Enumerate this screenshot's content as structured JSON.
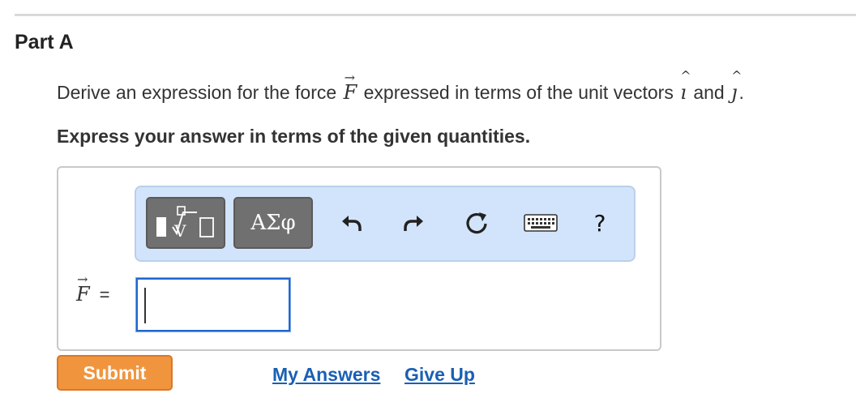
{
  "part": {
    "title": "Part A"
  },
  "question": {
    "prefix": "Derive an expression for the force",
    "force_symbol": "F",
    "middle": "expressed in terms of the unit vectors",
    "unit_i": "ı",
    "conjunction": "and",
    "unit_j": "ȷ",
    "suffix": "."
  },
  "instruction": "Express your answer in terms of the given quantities.",
  "toolbar": {
    "templates_icon": "math-templates-icon",
    "symbols_label": "ΑΣφ",
    "undo_icon": "undo-icon",
    "redo_icon": "redo-icon",
    "reset_icon": "reset-icon",
    "keyboard_icon": "keyboard-icon",
    "help_label": "?"
  },
  "answer": {
    "label_symbol": "F",
    "equals": "=",
    "value": ""
  },
  "actions": {
    "submit_label": "Submit",
    "my_answers_label": "My Answers",
    "give_up_label": "Give Up"
  },
  "colors": {
    "toolbar_bg": "#d2e4fb",
    "submit_bg": "#f0953e",
    "link": "#1a5fb4",
    "input_border": "#1f67cf"
  }
}
